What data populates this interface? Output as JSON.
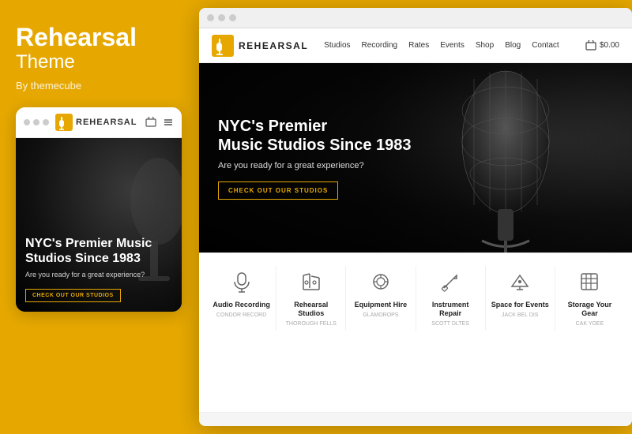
{
  "left": {
    "title1": "Rehearsal",
    "title2": "Theme",
    "by": "By themecube",
    "mobile": {
      "hero_heading": "NYC's Premier Music Studios Since 1983",
      "hero_sub": "Are you ready for a great experience?",
      "cta": "CHECK OUT OUR STUDIOS",
      "logo_text": "REHEARSAL"
    }
  },
  "desktop": {
    "logo_text": "REHEARSAL",
    "nav": [
      "Studios",
      "Recording",
      "Rates",
      "Events",
      "Shop",
      "Blog",
      "Contact"
    ],
    "cart": "$0.00",
    "hero": {
      "heading1": "NYC's Premier",
      "heading2": "Music Studios Since 1983",
      "sub": "Are you ready for a great experience?",
      "cta": "CHECK OUT OUR STUDIOS"
    },
    "features": [
      {
        "title": "Audio Recording",
        "desc": "CONDOR RECORD",
        "icon": "mic"
      },
      {
        "title": "Rehearsal Studios",
        "desc": "THOROUGH FELLS",
        "icon": "guitar"
      },
      {
        "title": "Equipment Hire",
        "desc": "GLAMOROPS",
        "icon": "headphones"
      },
      {
        "title": "Instrument Repair",
        "desc": "SCOTT DLTES",
        "icon": "wrench"
      },
      {
        "title": "Space for Events",
        "desc": "JACK BEL DIS",
        "icon": "megaphone"
      },
      {
        "title": "Storage Your Gear",
        "desc": "CAK YOEE",
        "icon": "box"
      }
    ]
  },
  "colors": {
    "accent": "#e6a800",
    "dark": "#111111"
  }
}
